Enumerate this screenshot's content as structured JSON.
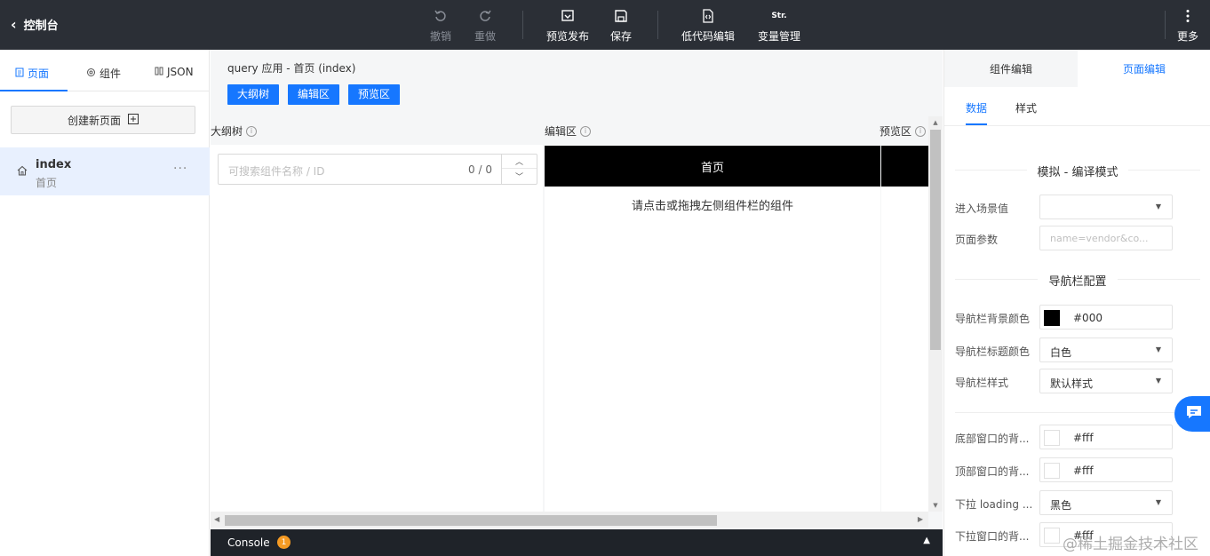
{
  "topbar": {
    "back_label": "控制台",
    "buttons": [
      {
        "label": "撤销",
        "icon": "undo-icon",
        "disabled": true
      },
      {
        "label": "重做",
        "icon": "redo-icon",
        "disabled": true
      },
      {
        "label": "预览发布",
        "icon": "publish-icon",
        "disabled": false
      },
      {
        "label": "保存",
        "icon": "save-icon",
        "disabled": false
      },
      {
        "label": "低代码编辑",
        "icon": "lowcode-icon",
        "disabled": false
      },
      {
        "label": "变量管理",
        "icon": "variable-icon",
        "icon_text": "Str.",
        "disabled": false
      },
      {
        "label": "更多",
        "icon": "more-vertical-icon",
        "disabled": false
      }
    ]
  },
  "left": {
    "tabs": [
      {
        "label": "页面",
        "icon": "page-icon",
        "active": true
      },
      {
        "label": "组件",
        "icon": "component-icon",
        "active": false
      },
      {
        "label": "JSON",
        "icon": "json-icon",
        "active": false
      }
    ],
    "create_label": "创建新页面",
    "pages": [
      {
        "name": "index",
        "title": "首页",
        "more": "···"
      }
    ]
  },
  "main": {
    "breadcrumb": "query 应用 - 首页 (index)",
    "view_buttons": [
      "大纲树",
      "编辑区",
      "预览区"
    ],
    "columns": {
      "tree": "大纲树",
      "editor": "编辑区",
      "preview": "预览区"
    },
    "search": {
      "placeholder": "可搜索组件名称 / ID",
      "count": "0 / 0"
    },
    "editor": {
      "nav_title": "首页",
      "hint": "请点击或拖拽左侧组件栏的组件"
    }
  },
  "console": {
    "label": "Console",
    "badge": "1"
  },
  "right": {
    "tabs": [
      {
        "label": "组件编辑",
        "active": false
      },
      {
        "label": "页面编辑",
        "active": true
      }
    ],
    "subtabs": [
      {
        "label": "数据",
        "active": true
      },
      {
        "label": "样式",
        "active": false
      }
    ],
    "sections": {
      "compile": "模拟 - 编译模式",
      "navbar": "导航栏配置"
    },
    "fields": {
      "scene": {
        "label": "进入场景值",
        "value": ""
      },
      "params": {
        "label": "页面参数",
        "placeholder": "name=vendor&co..."
      },
      "nav_bg": {
        "label": "导航栏背景颜色",
        "value": "#000",
        "swatch": "#000000"
      },
      "nav_title_color": {
        "label": "导航栏标题颜色",
        "value": "白色"
      },
      "nav_style": {
        "label": "导航栏样式",
        "value": "默认样式"
      },
      "bottom_bg": {
        "label": "底部窗口的背...",
        "value": "#fff",
        "swatch": "#ffffff"
      },
      "top_bg": {
        "label": "顶部窗口的背...",
        "value": "#fff",
        "swatch": "#ffffff"
      },
      "loading_style": {
        "label": "下拉 loading ...",
        "value": "黑色"
      },
      "pull_bg": {
        "label": "下拉窗口的背...",
        "value": "#fff",
        "swatch": "#ffffff"
      }
    }
  },
  "watermark": "@稀土掘金技术社区",
  "colors": {
    "accent": "#1677ff",
    "topbar": "#2b2f36",
    "badge": "#f59a23"
  }
}
